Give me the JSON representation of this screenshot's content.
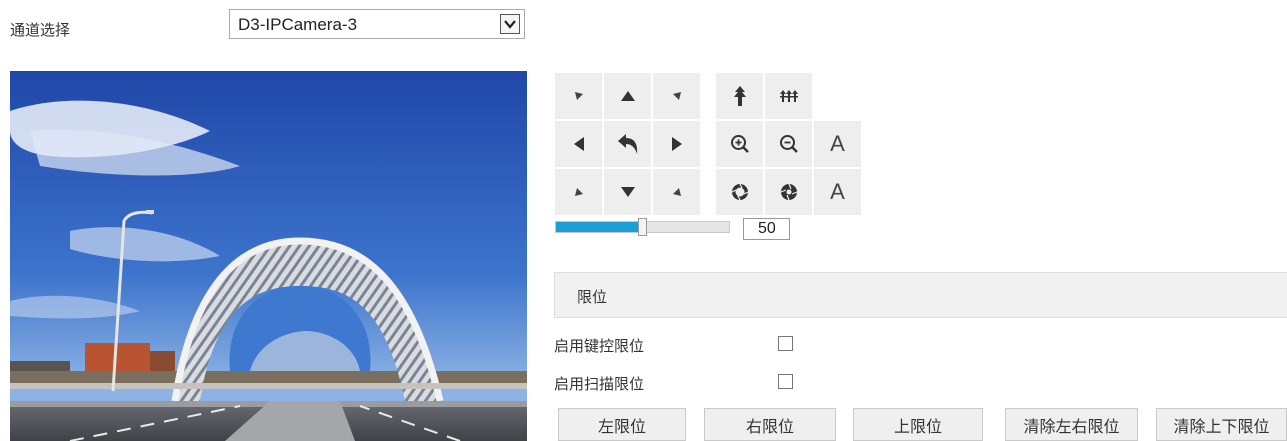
{
  "channel": {
    "label": "通道选择",
    "selected": "D3-IPCamera-3",
    "dropdown_icon": "chevron-down-icon"
  },
  "video": {
    "content": "live camera feed"
  },
  "ptz": {
    "zoom_auto_label": "A",
    "iris_auto_label": "A",
    "speed_value": "50",
    "speed_fraction": 0.5,
    "accent_color": "#1a9fd6"
  },
  "limit": {
    "title": "限位",
    "options": [
      {
        "label": "启用键控限位",
        "checked": false
      },
      {
        "label": "启用扫描限位",
        "checked": false
      }
    ],
    "buttons": [
      "左限位",
      "右限位",
      "上限位",
      "清除左右限位",
      "清除上下限位"
    ]
  }
}
